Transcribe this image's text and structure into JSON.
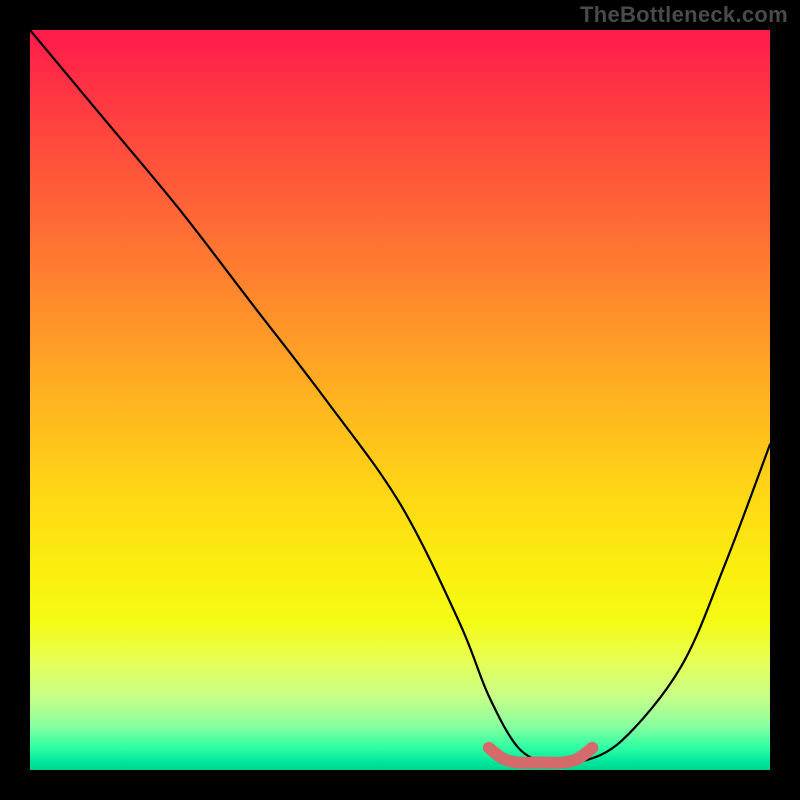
{
  "watermark": "TheBottleneck.com",
  "chart_data": {
    "type": "line",
    "title": "",
    "xlabel": "",
    "ylabel": "",
    "xlim": [
      0,
      100
    ],
    "ylim": [
      0,
      100
    ],
    "series": [
      {
        "name": "bottleneck-curve",
        "x": [
          0,
          10,
          20,
          30,
          40,
          50,
          58,
          62,
          66,
          70,
          74,
          80,
          88,
          94,
          100
        ],
        "y": [
          100,
          88,
          76,
          63,
          50,
          36,
          20,
          10,
          3,
          1,
          1,
          4,
          14,
          28,
          44
        ]
      },
      {
        "name": "optimal-band",
        "x": [
          62,
          64,
          66,
          68,
          70,
          72,
          74,
          76
        ],
        "y": [
          3,
          1.5,
          1,
          1,
          1,
          1,
          1.5,
          3
        ]
      }
    ],
    "colors": {
      "curve": "#000000",
      "optimal_band": "#d46a6a",
      "gradient_top": "#ff1a4b",
      "gradient_bottom": "#00d58e"
    }
  }
}
